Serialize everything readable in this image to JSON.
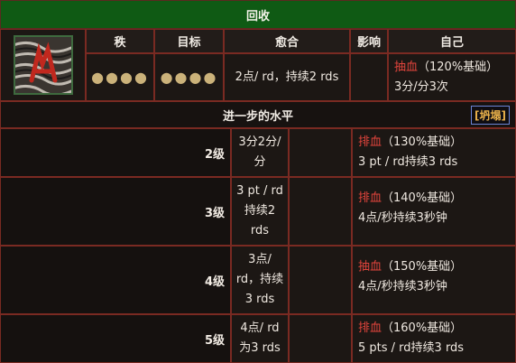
{
  "title": "回收",
  "header": {
    "col_rank": "秩",
    "col_target": "目标",
    "col_heal": "愈合",
    "col_effect": "影响",
    "col_self": "自己"
  },
  "base_row": {
    "rank_dots": "●●●●",
    "target_dots": "●●●●",
    "heal": "2点/ rd，持续2 rds",
    "effect": "",
    "self_keyword": "抽血",
    "self_pct": "（120%基础）",
    "self_line2": "3分/分3次"
  },
  "further_levels": {
    "label": "进一步的水平",
    "toggle": "[坍塌]"
  },
  "levels": [
    {
      "label": "2级",
      "heal": "3分2分/\n分",
      "effect": "",
      "self_keyword": "排血",
      "self_pct": "（130%基础）",
      "self_line2": "3 pt / rd持续3 rds"
    },
    {
      "label": "3级",
      "heal": "3 pt / rd\n持续2\nrds",
      "effect": "",
      "self_keyword": "排血",
      "self_pct": "（140%基础）",
      "self_line2": "4点/秒持续3秒钟"
    },
    {
      "label": "4级",
      "heal": "3点/\nrd，持续\n3 rds",
      "effect": "",
      "self_keyword": "抽血",
      "self_pct": "（150%基础）",
      "self_line2": "4点/秒持续3秒钟"
    },
    {
      "label": "5级",
      "heal": "4点/ rd\n为3 rds",
      "effect": "",
      "self_keyword": "排血",
      "self_pct": "（160%基础）",
      "self_line2": "5 pts / rd持续3 rds"
    }
  ],
  "icon": {
    "name": "rune-icon",
    "accent": "#c0281e",
    "border": "#3e6a3e"
  },
  "colors": {
    "title_bar": "#0f5a14",
    "border": "#7a2a22",
    "keyword_red": "#e0443c",
    "dots": "#cbb27a"
  }
}
